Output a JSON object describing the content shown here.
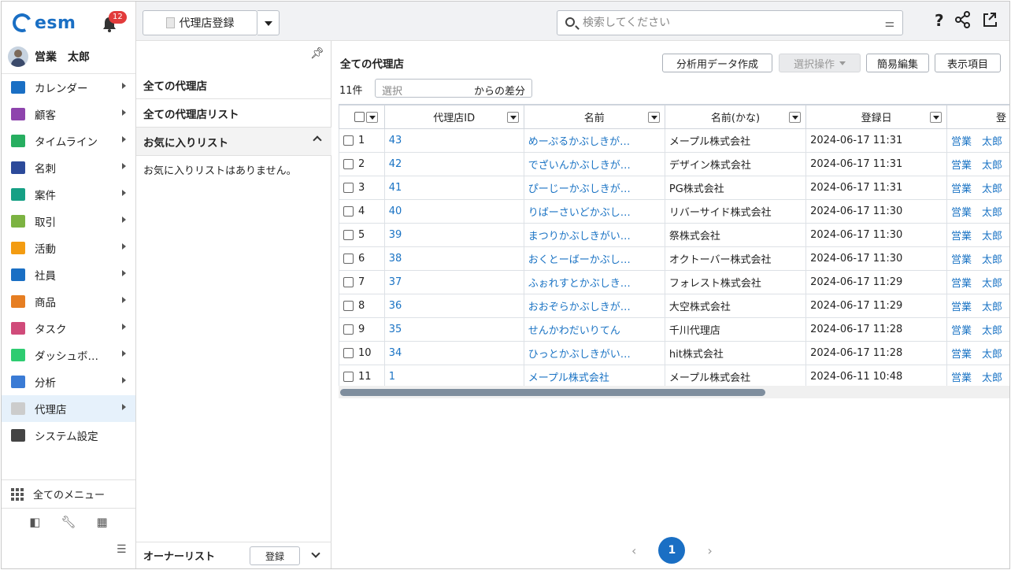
{
  "app": {
    "logo_text": "esm",
    "notification_count": "12",
    "user_name": "営業　太郎"
  },
  "nav": {
    "items": [
      {
        "label": "カレンダー",
        "color": "#1a6fc4"
      },
      {
        "label": "顧客",
        "color": "#8e44ad"
      },
      {
        "label": "タイムライン",
        "color": "#27ae60"
      },
      {
        "label": "名刺",
        "color": "#2c4a9a"
      },
      {
        "label": "案件",
        "color": "#16a085"
      },
      {
        "label": "取引",
        "color": "#7cb342"
      },
      {
        "label": "活動",
        "color": "#f39c12"
      },
      {
        "label": "社員",
        "color": "#1a6fc4"
      },
      {
        "label": "商品",
        "color": "#e67e22"
      },
      {
        "label": "タスク",
        "color": "#d04b7a"
      },
      {
        "label": "ダッシュボ…",
        "color": "#2ecc71"
      },
      {
        "label": "分析",
        "color": "#3a7bd5"
      },
      {
        "label": "代理店",
        "color": "#cccccc"
      },
      {
        "label": "システム設定",
        "color": "#444444"
      }
    ],
    "all_menu": "全てのメニュー"
  },
  "topbar": {
    "register_label": "代理店登録",
    "search_placeholder": "検索してください"
  },
  "listpanel": {
    "all": "全ての代理店",
    "all_list": "全ての代理店リスト",
    "favorites": "お気に入りリスト",
    "favorites_empty": "お気に入りリストはありません。",
    "owner_list": "オーナーリスト",
    "owner_register": "登録"
  },
  "main": {
    "title": "全ての代理店",
    "btn_analysis": "分析用データ作成",
    "btn_select_op": "選択操作",
    "btn_quick_edit": "簡易編集",
    "btn_columns": "表示項目",
    "count": "11件",
    "diff_placeholder": "選択",
    "diff_suffix": "からの差分",
    "page": "1"
  },
  "table": {
    "headers": [
      "代理店ID",
      "名前",
      "名前(かな)",
      "登録日",
      "登"
    ],
    "rows": [
      {
        "no": "1",
        "id": "43",
        "kana": "めーぷるかぶしきが…",
        "name": "メープル株式会社",
        "date": "2024-06-17 11:31",
        "owner": "営業　太郎"
      },
      {
        "no": "2",
        "id": "42",
        "kana": "でざいんかぶしきが…",
        "name": "デザイン株式会社",
        "date": "2024-06-17 11:31",
        "owner": "営業　太郎"
      },
      {
        "no": "3",
        "id": "41",
        "kana": "ぴーじーかぶしきが…",
        "name": "PG株式会社",
        "date": "2024-06-17 11:31",
        "owner": "営業　太郎"
      },
      {
        "no": "4",
        "id": "40",
        "kana": "りばーさいどかぶし…",
        "name": "リバーサイド株式会社",
        "date": "2024-06-17 11:30",
        "owner": "営業　太郎"
      },
      {
        "no": "5",
        "id": "39",
        "kana": "まつりかぶしきがい…",
        "name": "祭株式会社",
        "date": "2024-06-17 11:30",
        "owner": "営業　太郎"
      },
      {
        "no": "6",
        "id": "38",
        "kana": "おくとーばーかぶし…",
        "name": "オクトーバー株式会社",
        "date": "2024-06-17 11:30",
        "owner": "営業　太郎"
      },
      {
        "no": "7",
        "id": "37",
        "kana": "ふぉれすとかぶしき…",
        "name": "フォレスト株式会社",
        "date": "2024-06-17 11:29",
        "owner": "営業　太郎"
      },
      {
        "no": "8",
        "id": "36",
        "kana": "おおぞらかぶしきが…",
        "name": "大空株式会社",
        "date": "2024-06-17 11:29",
        "owner": "営業　太郎"
      },
      {
        "no": "9",
        "id": "35",
        "kana": "せんかわだいりてん",
        "name": "千川代理店",
        "date": "2024-06-17 11:28",
        "owner": "営業　太郎"
      },
      {
        "no": "10",
        "id": "34",
        "kana": "ひっとかぶしきがい…",
        "name": "hit株式会社",
        "date": "2024-06-17 11:28",
        "owner": "営業　太郎"
      },
      {
        "no": "11",
        "id": "1",
        "kana": "メープル株式会社",
        "name": "メープル株式会社",
        "date": "2024-06-11 10:48",
        "owner": "営業　太郎"
      }
    ]
  }
}
